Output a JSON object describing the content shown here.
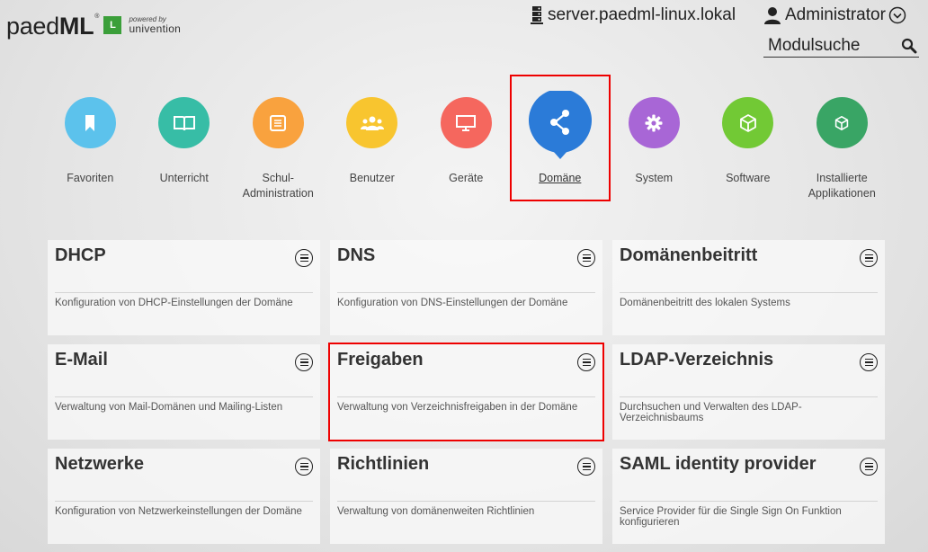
{
  "header": {
    "logo": {
      "name": "paedML",
      "badge": "L",
      "powered_by": "powered by",
      "vendor": "univention"
    },
    "server": "server.paedml-linux.lokal",
    "user": "Administrator",
    "search_placeholder": "Modulsuche"
  },
  "categories": [
    {
      "label": "Favoriten",
      "color": "#5cc2ec",
      "icon": "bookmark-icon"
    },
    {
      "label": "Unterricht",
      "color": "#37bda6",
      "icon": "book-icon"
    },
    {
      "label": "Schul-\nAdministration",
      "color": "#f9a23e",
      "icon": "school-admin-icon"
    },
    {
      "label": "Benutzer",
      "color": "#f8c52f",
      "icon": "users-icon"
    },
    {
      "label": "Geräte",
      "color": "#f5675e",
      "icon": "monitor-icon"
    },
    {
      "label": "Domäne",
      "color": "#2b7bd8",
      "icon": "share-icon",
      "active": true
    },
    {
      "label": "System",
      "color": "#a866d6",
      "icon": "gear-icon"
    },
    {
      "label": "Software",
      "color": "#72c935",
      "icon": "package-icon"
    },
    {
      "label": "Installierte\nApplikationen",
      "color": "#39a565",
      "icon": "apps-icon"
    }
  ],
  "modules": [
    {
      "title": "DHCP",
      "desc": "Konfiguration von DHCP-Einstellungen der Domäne"
    },
    {
      "title": "DNS",
      "desc": "Konfiguration von DNS-Einstellungen der Domäne"
    },
    {
      "title": "Domänenbeitritt",
      "desc": "Domänenbeitritt des lokalen Systems"
    },
    {
      "title": "E-Mail",
      "desc": "Verwaltung von Mail-Domänen und Mailing-Listen"
    },
    {
      "title": "Freigaben",
      "desc": "Verwaltung von Verzeichnisfreigaben in der Domäne"
    },
    {
      "title": "LDAP-Verzeichnis",
      "desc": "Durchsuchen und Verwalten des LDAP-Verzeichnisbaums"
    },
    {
      "title": "Netzwerke",
      "desc": "Konfiguration von Netzwerkeinstellungen der Domäne"
    },
    {
      "title": "Richtlinien",
      "desc": "Verwaltung von domänenweiten Richtlinien"
    },
    {
      "title": "SAML identity provider",
      "desc": "Service Provider für die Single Sign On Funktion konfigurieren"
    }
  ]
}
